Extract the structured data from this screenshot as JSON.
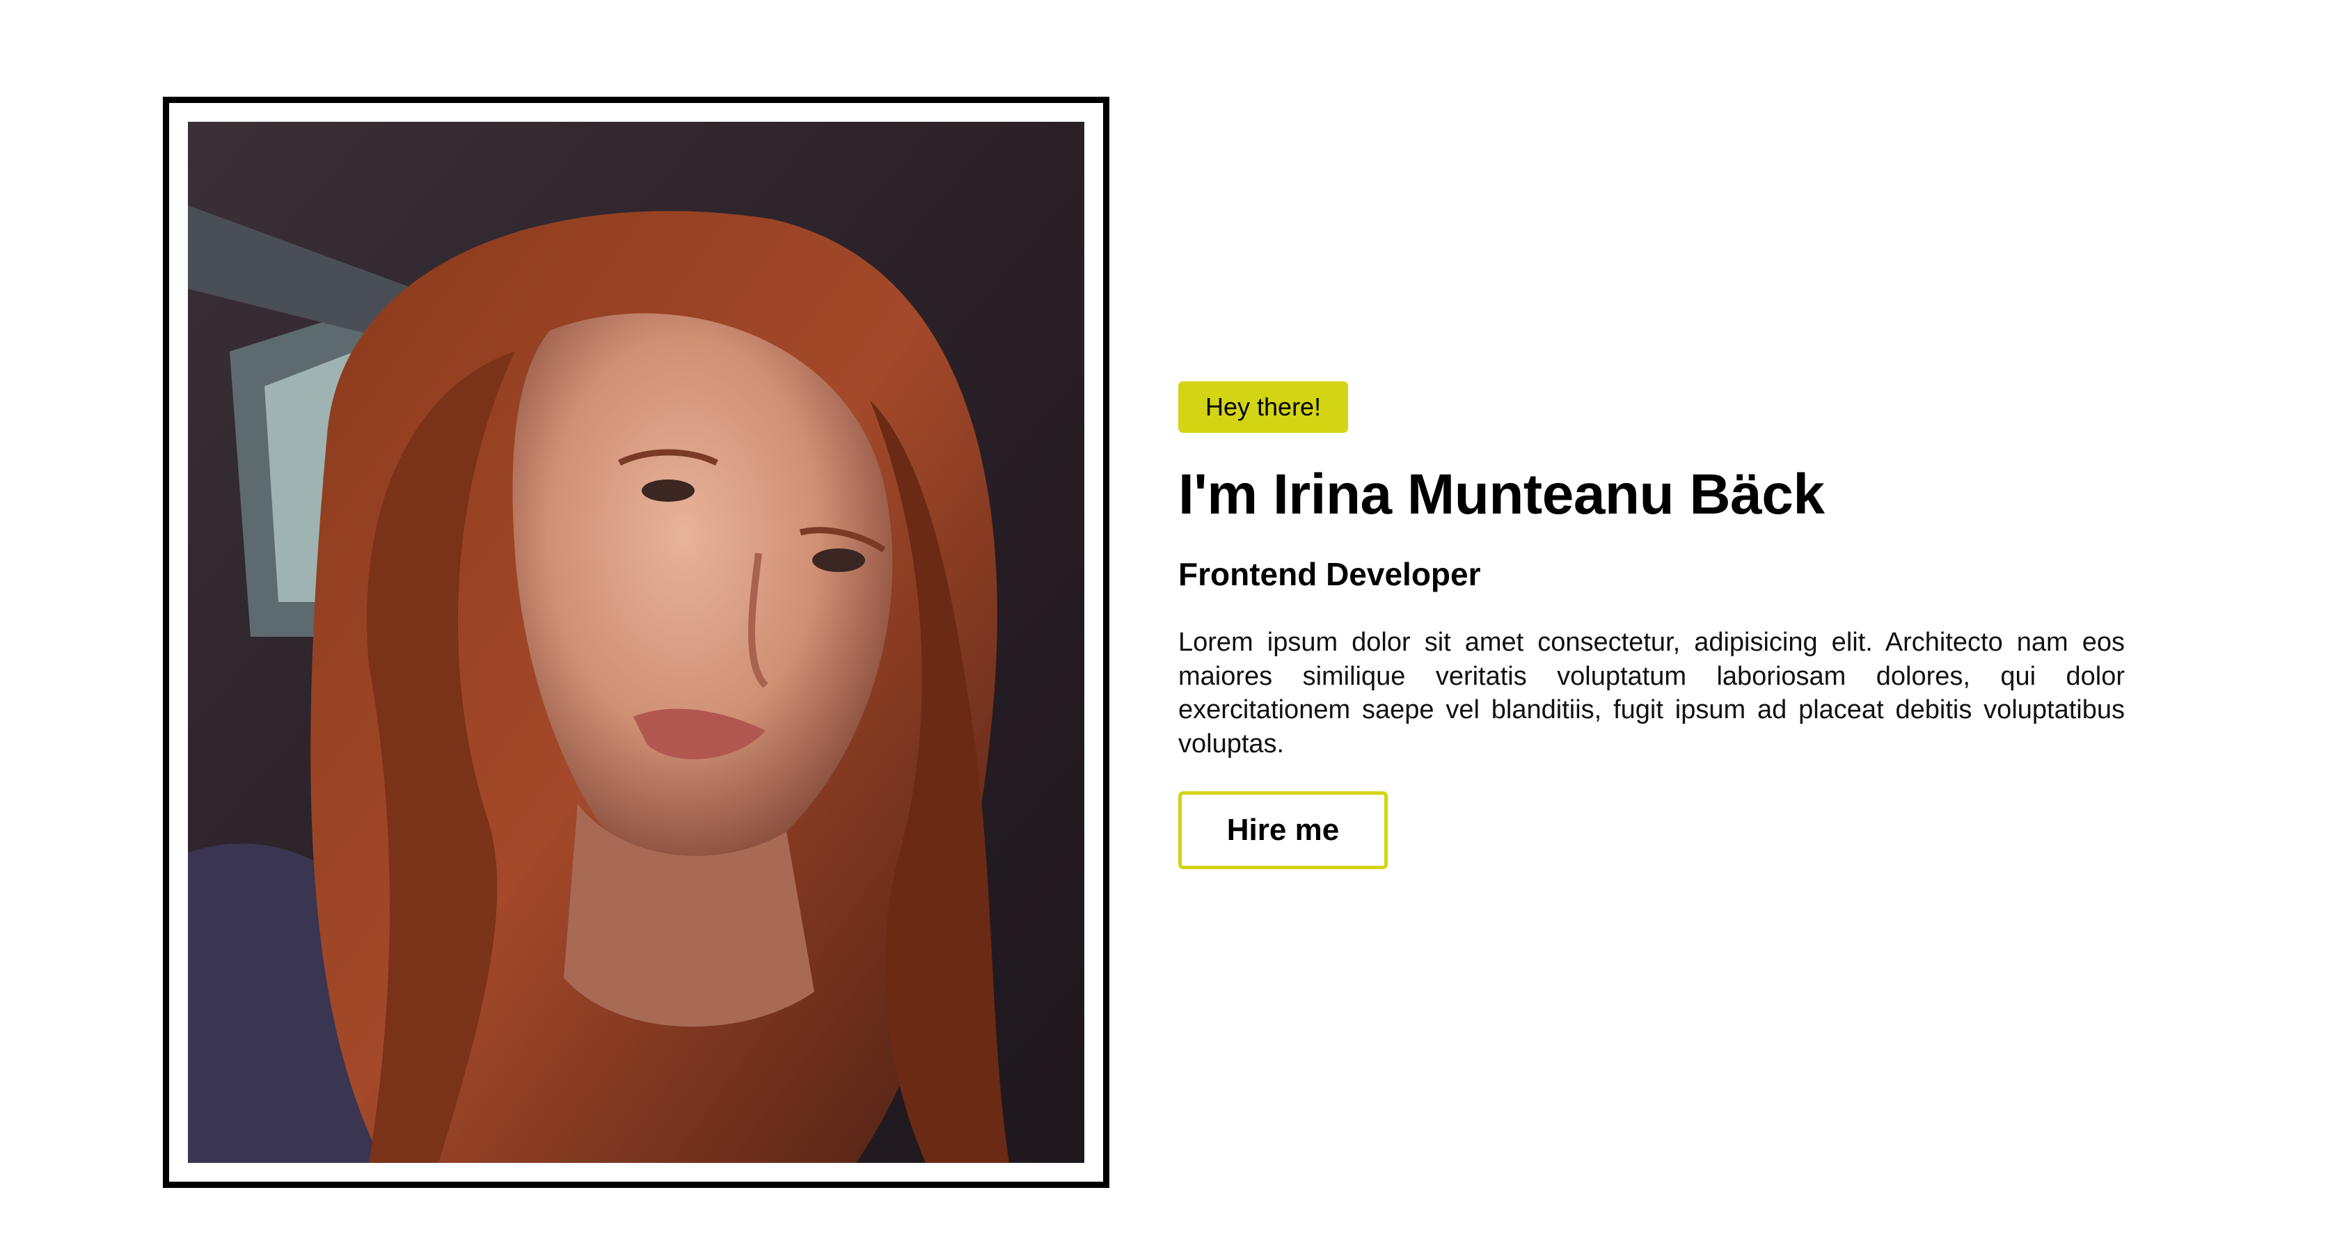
{
  "hero": {
    "badge": "Hey there!",
    "title": "I'm Irina Munteanu Bäck",
    "role": "Frontend Developer",
    "bio": "Lorem ipsum dolor sit amet consectetur, adipisicing elit. Architecto nam eos maiores similique veritatis voluptatum laboriosam dolores, qui dolor exercitationem saepe vel blanditiis, fugit ipsum ad placeat debitis voluptatibus voluptas.",
    "cta_label": "Hire me"
  },
  "colors": {
    "accent": "#d3d414",
    "frame": "#000000",
    "background": "#ffffff",
    "text": "#111111"
  },
  "icons": {
    "photo": "profile-photo"
  }
}
